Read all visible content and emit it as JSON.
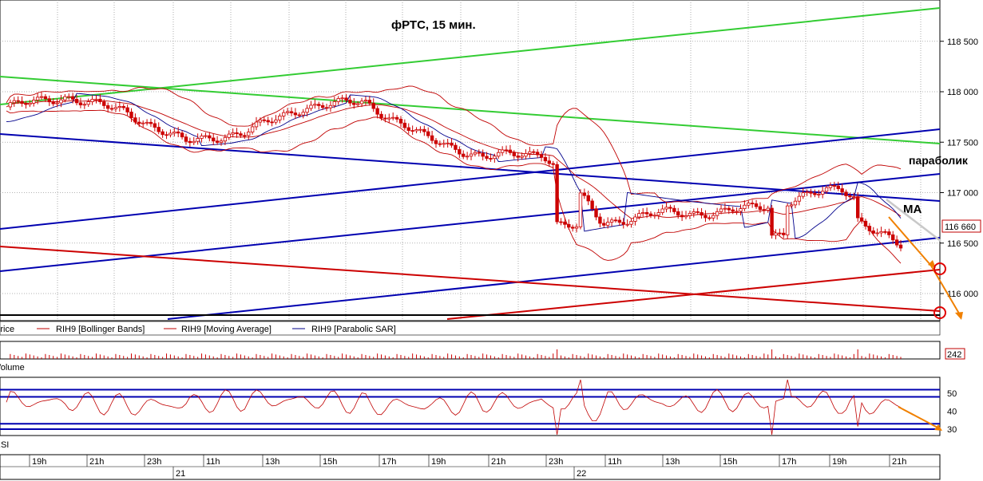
{
  "chart_data": [
    {
      "type": "line",
      "title": "фРТС,  15 мин.",
      "annotations": [
        "параболик",
        "МА"
      ],
      "y_range": [
        115800,
        118900
      ],
      "y_ticks": [
        116000,
        116500,
        117000,
        117500,
        118000,
        118500
      ],
      "y_tick_labels": [
        "116 000",
        "116 500",
        "117 000",
        "117 500",
        "118 000",
        "118 500"
      ],
      "last_price_label": "116 660",
      "legend": [
        "Price",
        "RIH9 [Bollinger Bands]",
        "RIH9 [Moving Average]",
        "RIH9 [Parabolic SAR]"
      ],
      "grid": true,
      "colors": {
        "up": "#cc0000",
        "down": "#cc0000",
        "bands": "#c00000",
        "ma": "#c00000",
        "sar": "#00008b",
        "trend_green": "#33cc33",
        "trend_blue": "#0000b0",
        "trend_red": "#cc0000",
        "arrow": "#f08000"
      },
      "close_points": [
        {
          "x": "19h",
          "y": 117850
        },
        {
          "x": "21h",
          "y": 117950
        },
        {
          "x": "23h",
          "y": 117800
        },
        {
          "x": "11h",
          "y": 117500
        },
        {
          "x": "13h",
          "y": 117600
        },
        {
          "x": "15h",
          "y": 117850
        },
        {
          "x": "17h",
          "y": 117900
        },
        {
          "x": "19h",
          "y": 117550
        },
        {
          "x": "21h",
          "y": 117350
        },
        {
          "x": "23h",
          "y": 117400
        },
        {
          "x": "11h",
          "y": 116700
        },
        {
          "x": "13h",
          "y": 116800
        },
        {
          "x": "15h",
          "y": 116800
        },
        {
          "x": "17h",
          "y": 116900
        },
        {
          "x": "19h",
          "y": 117050
        },
        {
          "x": "21h",
          "y": 116660
        }
      ]
    },
    {
      "type": "bar",
      "title": "Volume",
      "last_value_label": "242"
    },
    {
      "type": "line",
      "title": "RSI",
      "y_ticks": [
        30,
        40,
        50
      ],
      "y_tick_labels": [
        "30",
        "40",
        "50"
      ],
      "levels": [
        30,
        33,
        48,
        52
      ]
    }
  ],
  "time_axis": {
    "hours": [
      "19h",
      "21h",
      "23h",
      "11h",
      "13h",
      "15h",
      "17h",
      "19h",
      "21h",
      "23h",
      "11h",
      "13h",
      "15h",
      "17h",
      "19h",
      "21h"
    ],
    "days": [
      "21",
      "22"
    ]
  }
}
